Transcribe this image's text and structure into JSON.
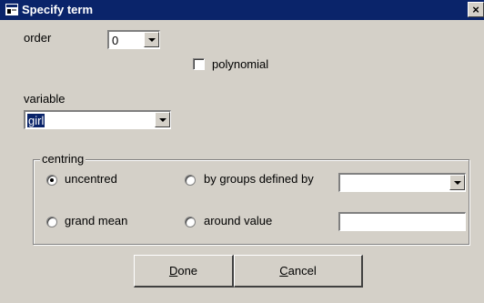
{
  "window": {
    "title": "Specify term",
    "close_label": "×"
  },
  "order": {
    "label": "order",
    "value": "0"
  },
  "polynomial": {
    "label": "polynomial",
    "checked": false
  },
  "variable": {
    "label": "variable",
    "value": "girl"
  },
  "centring": {
    "title": "centring",
    "options": {
      "uncentred": "uncentred",
      "by_groups": "by groups defined by",
      "grand_mean": "grand mean",
      "around_value": "around value"
    },
    "selected": "uncentred",
    "by_groups_value": "",
    "around_value_value": ""
  },
  "buttons": {
    "done_mnemonic": "D",
    "done_rest": "one",
    "cancel_mnemonic": "C",
    "cancel_rest": "ancel"
  }
}
